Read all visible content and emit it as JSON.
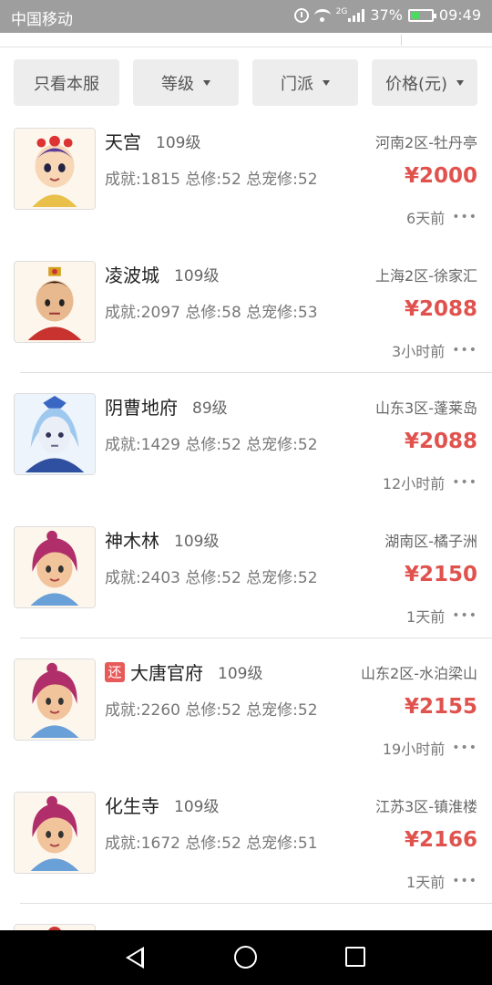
{
  "status_bar": {
    "carrier": "中国移动",
    "network_gen": "2G",
    "battery_percent": "37%",
    "time": "09:49"
  },
  "filters": [
    {
      "label": "只看本服",
      "has_caret": false
    },
    {
      "label": "等级",
      "has_caret": true
    },
    {
      "label": "门派",
      "has_caret": true
    },
    {
      "label": "价格(元)",
      "has_caret": true
    }
  ],
  "items": [
    {
      "name": "天宫",
      "level": "109级",
      "server": "河南2区-牡丹亭",
      "stats": "成就:1815 总修:52 总宠修:52",
      "price": "¥2000",
      "time": "6天前",
      "returned": false,
      "avatar": "tiangong-character-avatar"
    },
    {
      "name": "凌波城",
      "level": "109级",
      "server": "上海2区-徐家汇",
      "stats": "成就:2097 总修:58 总宠修:53",
      "price": "¥2088",
      "time": "3小时前",
      "returned": false,
      "avatar": "lingbocheng-character-avatar"
    },
    {
      "name": "阴曹地府",
      "level": "89级",
      "server": "山东3区-蓬莱岛",
      "stats": "成就:1429 总修:52 总宠修:52",
      "price": "¥2088",
      "time": "12小时前",
      "returned": false,
      "avatar": "yincaodifu-character-avatar"
    },
    {
      "name": "神木林",
      "level": "109级",
      "server": "湖南区-橘子洲",
      "stats": "成就:2403 总修:52 总宠修:52",
      "price": "¥2150",
      "time": "1天前",
      "returned": false,
      "avatar": "shenmulin-character-avatar"
    },
    {
      "name": "大唐官府",
      "level": "109级",
      "server": "山东2区-水泊梁山",
      "stats": "成就:2260 总修:52 总宠修:52",
      "price": "¥2155",
      "time": "19小时前",
      "returned": true,
      "badge": "还",
      "avatar": "datangguanfu-character-avatar"
    },
    {
      "name": "化生寺",
      "level": "109级",
      "server": "江苏3区-镇淮楼",
      "stats": "成就:1672 总修:52 总宠修:51",
      "price": "¥2166",
      "time": "1天前",
      "returned": false,
      "avatar": "huashengsi-character-avatar"
    }
  ],
  "nav": {
    "back": "back-icon",
    "home": "home-icon",
    "recent": "recent-apps-icon"
  },
  "colors": {
    "price": "#e0524e",
    "badge": "#e85a5a",
    "status_bar": "#9e9e9e"
  }
}
